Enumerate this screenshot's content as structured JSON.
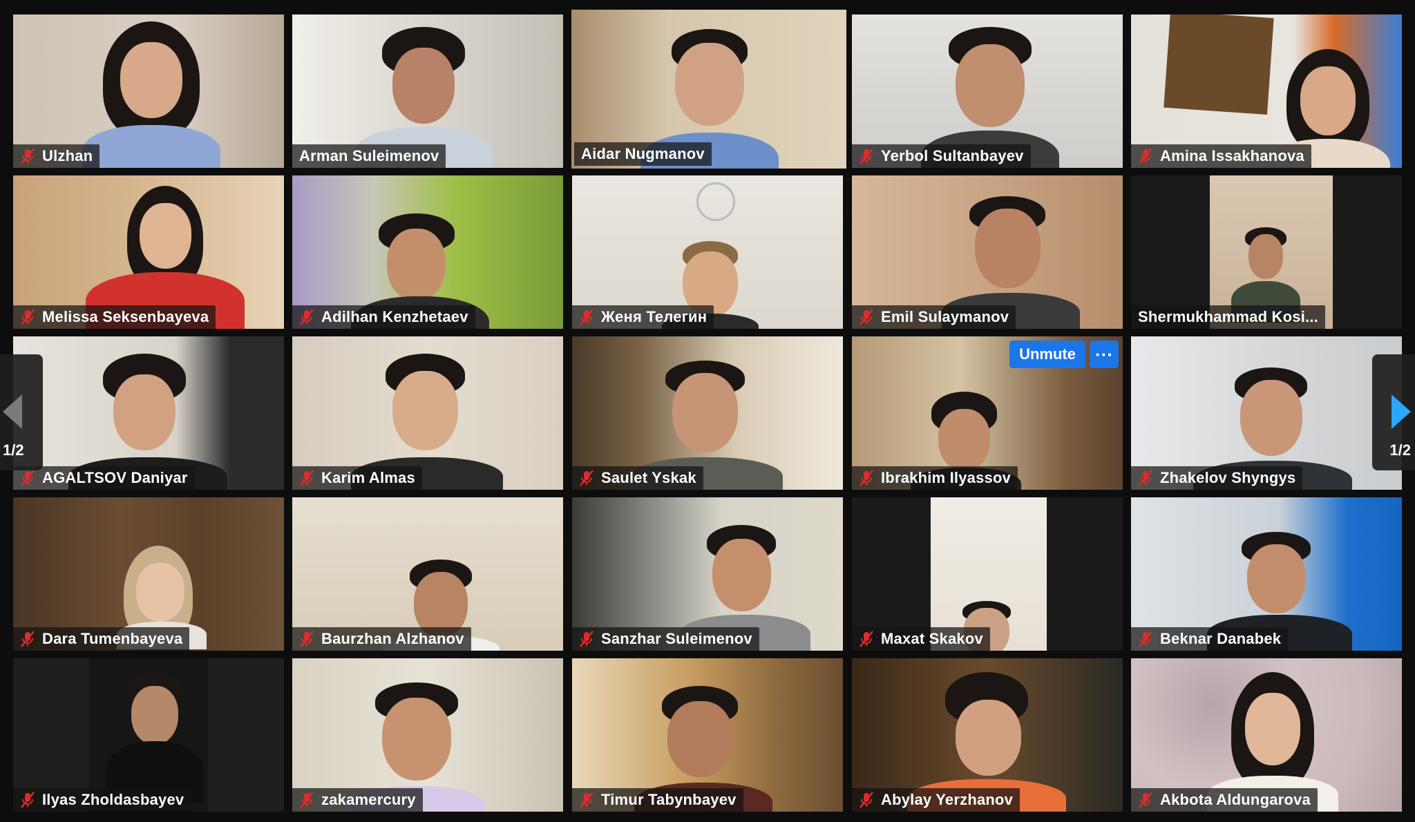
{
  "meeting": {
    "pagination": {
      "left": {
        "label": "1/2"
      },
      "right": {
        "label": "1/2"
      }
    },
    "tile_controls": {
      "unmute_label": "Unmute",
      "more_label": "···"
    },
    "colors": {
      "active_speaker_border": "#c9e24a",
      "accent_blue": "#1b76e8",
      "muted_red": "#e02b2b"
    },
    "participants": [
      {
        "name": "Ulzhan",
        "muted": true
      },
      {
        "name": "Arman Suleimenov",
        "muted": false
      },
      {
        "name": "Aidar Nugmanov",
        "muted": false,
        "active_speaker": true
      },
      {
        "name": "Yerbol Sultanbayev",
        "muted": true
      },
      {
        "name": "Amina Issakhanova",
        "muted": true
      },
      {
        "name": "Melissa Seksenbayeva",
        "muted": true
      },
      {
        "name": "Adilhan Kenzhetaev",
        "muted": true
      },
      {
        "name": "Женя Телегин",
        "muted": true
      },
      {
        "name": "Emil Sulaymanov",
        "muted": true
      },
      {
        "name": "Shermukhammad Kosi...",
        "muted": false
      },
      {
        "name": "AGALTSOV Daniyar",
        "muted": true
      },
      {
        "name": "Karim Almas",
        "muted": true
      },
      {
        "name": "Saulet Yskak",
        "muted": true
      },
      {
        "name": "Ibrakhim Ilyassov",
        "muted": true,
        "hover_controls": true
      },
      {
        "name": "Zhakelov Shyngys",
        "muted": true
      },
      {
        "name": "Dara Tumenbayeva",
        "muted": true
      },
      {
        "name": "Baurzhan Alzhanov",
        "muted": true
      },
      {
        "name": "Sanzhar Suleimenov",
        "muted": true
      },
      {
        "name": "Maxat Skakov",
        "muted": true
      },
      {
        "name": "Beknar Danabek",
        "muted": true
      },
      {
        "name": "Ilyas Zholdasbayev",
        "muted": true
      },
      {
        "name": "zakamercury",
        "muted": true
      },
      {
        "name": "Timur Tabynbayev",
        "muted": true
      },
      {
        "name": "Abylay Yerzhanov",
        "muted": true
      },
      {
        "name": "Akbota Aldungarova",
        "muted": true
      }
    ]
  }
}
